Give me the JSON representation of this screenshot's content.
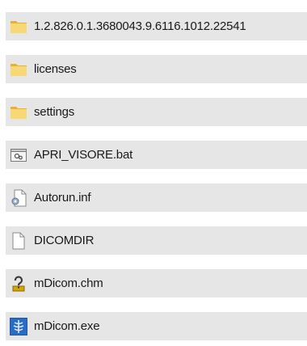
{
  "files": [
    {
      "name": "1.2.826.0.1.3680043.9.6116.1012.22541",
      "icon": "folder-icon"
    },
    {
      "name": "licenses",
      "icon": "folder-icon"
    },
    {
      "name": "settings",
      "icon": "folder-icon"
    },
    {
      "name": "APRI_VISORE.bat",
      "icon": "batch-file-icon"
    },
    {
      "name": "Autorun.inf",
      "icon": "setup-info-file-icon"
    },
    {
      "name": "DICOMDIR",
      "icon": "blank-file-icon"
    },
    {
      "name": "mDicom.chm",
      "icon": "help-file-icon"
    },
    {
      "name": "mDicom.exe",
      "icon": "mdicom-app-icon"
    }
  ],
  "colors": {
    "item_background": "#e6e6e6",
    "folder_yellow": "#f8d775",
    "folder_dark": "#e0a800",
    "app_blue": "#1e5aa8"
  }
}
